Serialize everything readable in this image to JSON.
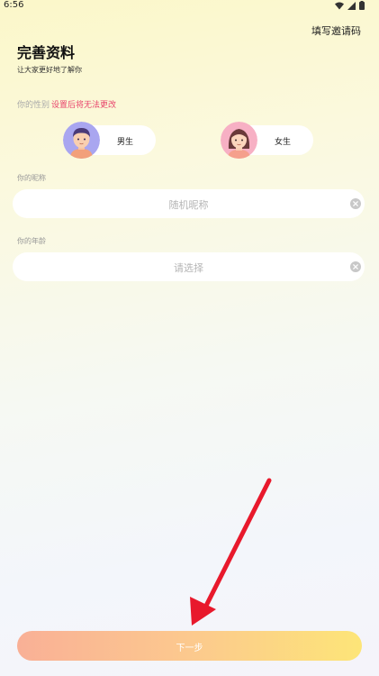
{
  "status_bar": {
    "time": "6:56",
    "icons": [
      "wifi-icon",
      "signal-icon",
      "battery-icon"
    ]
  },
  "header": {
    "invite_link": "填写邀请码"
  },
  "page": {
    "title": "完善资料",
    "subtitle": "让大家更好地了解你"
  },
  "gender": {
    "label": "你的性别",
    "warning": "设置后将无法更改",
    "options": [
      {
        "label": "男生",
        "avatar": "boy-avatar-icon"
      },
      {
        "label": "女生",
        "avatar": "girl-avatar-icon"
      }
    ]
  },
  "nickname": {
    "label": "你的昵称",
    "placeholder": "随机昵称"
  },
  "age": {
    "label": "你的年龄",
    "placeholder": "请选择"
  },
  "next_button": {
    "label": "下一步"
  },
  "colors": {
    "warning": "#e8436c",
    "button_gradient_start": "#f9b096",
    "button_gradient_end": "#fde578",
    "arrow": "#e8192c"
  }
}
